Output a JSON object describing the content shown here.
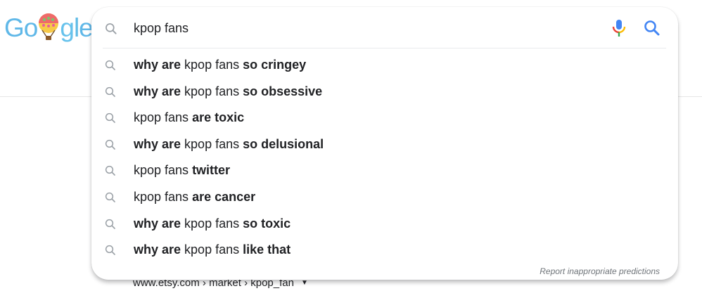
{
  "logo": {
    "text": "Google",
    "colors": {
      "G": "#60b8e8",
      "o": "#60b8e8",
      "g": "#66c2ec",
      "l": "#5fbbe6",
      "e": "#60b8e8"
    }
  },
  "search": {
    "query": "kpop fans",
    "icons": {
      "leading": "search-icon",
      "mic": "mic-icon",
      "submit": "search-icon"
    }
  },
  "suggestions": [
    {
      "parts": [
        {
          "text": "why are",
          "bold": true
        },
        {
          "text": " kpop fans ",
          "bold": false
        },
        {
          "text": "so cringey",
          "bold": true
        }
      ]
    },
    {
      "parts": [
        {
          "text": "why are",
          "bold": true
        },
        {
          "text": " kpop fans ",
          "bold": false
        },
        {
          "text": "so obsessive",
          "bold": true
        }
      ]
    },
    {
      "parts": [
        {
          "text": "kpop fans ",
          "bold": false
        },
        {
          "text": "are toxic",
          "bold": true
        }
      ]
    },
    {
      "parts": [
        {
          "text": "why are",
          "bold": true
        },
        {
          "text": " kpop fans ",
          "bold": false
        },
        {
          "text": "so delusional",
          "bold": true
        }
      ]
    },
    {
      "parts": [
        {
          "text": "kpop fans ",
          "bold": false
        },
        {
          "text": "twitter",
          "bold": true
        }
      ]
    },
    {
      "parts": [
        {
          "text": "kpop fans ",
          "bold": false
        },
        {
          "text": "are cancer",
          "bold": true
        }
      ]
    },
    {
      "parts": [
        {
          "text": "why are",
          "bold": true
        },
        {
          "text": " kpop fans ",
          "bold": false
        },
        {
          "text": "so toxic",
          "bold": true
        }
      ]
    },
    {
      "parts": [
        {
          "text": "why are",
          "bold": true
        },
        {
          "text": " kpop fans ",
          "bold": false
        },
        {
          "text": "like that",
          "bold": true
        }
      ]
    }
  ],
  "report_link": "Report inappropriate predictions",
  "result": {
    "url": "www.etsy.com › market › kpop_fan",
    "caret": "▼"
  },
  "colors": {
    "mic_blue": "#4285f4",
    "mic_red": "#ea4335",
    "mic_yellow": "#fbbc05",
    "mic_green": "#34a853",
    "search_blue": "#4285f4",
    "icon_grey": "#9aa0a6"
  }
}
